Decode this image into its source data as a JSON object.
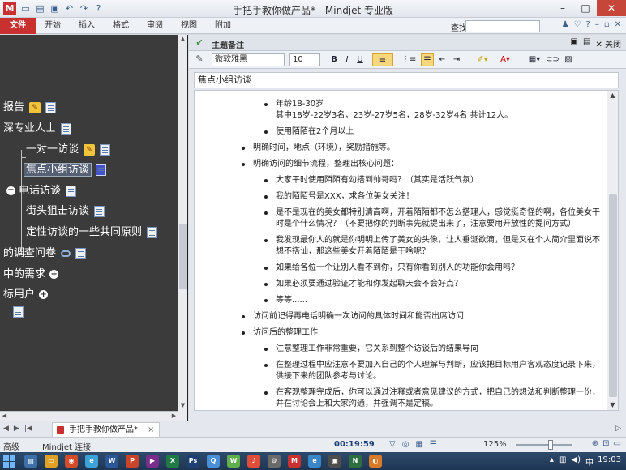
{
  "window": {
    "title": "手把手教你做产品* - Mindjet 专业版"
  },
  "ribbon": {
    "tabs": [
      "文件",
      "开始",
      "插入",
      "格式",
      "审阅",
      "视图",
      "附加"
    ],
    "find_label": "查找"
  },
  "map": {
    "nodes": [
      {
        "label": "报告",
        "badges": [
          "task",
          "note"
        ]
      },
      {
        "label": "深专业人士",
        "badges": [
          "note"
        ]
      },
      {
        "label": "一对一访谈",
        "badges": [
          "task",
          "note"
        ]
      },
      {
        "label": "焦点小组访谈",
        "badges": [
          "note"
        ],
        "selected": true
      },
      {
        "label": "电话访谈",
        "badges": [
          "note"
        ],
        "collapse": true
      },
      {
        "label": "街头狙击访谈",
        "badges": [
          "note"
        ]
      },
      {
        "label": "定性访谈的一些共同原则",
        "badges": [
          "note"
        ]
      },
      {
        "label": "的调查问卷",
        "badges": [
          "link",
          "note"
        ]
      },
      {
        "label": "中的需求",
        "badges": [
          "expand"
        ]
      },
      {
        "label": "标用户",
        "badges": [
          "expand"
        ]
      }
    ]
  },
  "notes": {
    "header_label": "主题备注",
    "close_label": "关闭",
    "font": "微软雅黑",
    "size": "10",
    "topic_title": "焦点小组访谈",
    "items": [
      {
        "level": 2,
        "text": "年龄18-30岁\n其中18岁-22岁3名，23岁-27岁5名，28岁-32岁4名 共计12人。"
      },
      {
        "level": 2,
        "text": "使用陌陌在2个月以上"
      },
      {
        "level": 1,
        "text": "明确时间，地点（环境），奖励措施等。"
      },
      {
        "level": 1,
        "text": "明确访问的细节流程，整理出核心问题："
      },
      {
        "level": 2,
        "text": "大家平时使用陌陌有勾搭到帅哥吗？（其实是活跃气氛）"
      },
      {
        "level": 2,
        "text": "我的陌陌号是XXX，求各位美女关注！"
      },
      {
        "level": 2,
        "text": "是不是现在的美女都特别清高啊，开着陌陌都不怎么搭理人，感觉挺奇怪的啊，各位美女平时是个什么情况？（不要把你的判断事先就提出来了，注意要用开放性的提问方式）"
      },
      {
        "level": 2,
        "text": "我发现最你人的就是你明明上传了美女的头像，让人垂涎欲滴，但是又在个人简介里面说不想不搭讪，那这些美女开着陌陌是干啥呢？"
      },
      {
        "level": 2,
        "text": "如果给各位一个让别人看不到你，只有你看到别人的功能你会用吗？"
      },
      {
        "level": 2,
        "text": "如果必须要通过验证才能和你发起聊天会不会好点？"
      },
      {
        "level": 2,
        "text": "等等......"
      },
      {
        "level": 1,
        "text": "访问前记得再电话明确一次访问的具体时间和能否出席访问"
      },
      {
        "level": 1,
        "text": "访问后的整理工作"
      },
      {
        "level": 2,
        "text": "注意整理工作非常重要，它关系到整个访谈后的结果导向"
      },
      {
        "level": 2,
        "text": "在整理过程中应注意不要加入自己的个人理解与判断，应该把目标用户客观态度记录下来，供接下来的团队参考与讨论。"
      },
      {
        "level": 2,
        "text": "在客观整理完成后，你可以通过注释或者意见建议的方式，把自己的想法和判断整理一份，并在讨论会上和大家沟通，并强调不是定稿。"
      }
    ]
  },
  "doc_tab": {
    "label": "手把手教你做产品*",
    "close": "×"
  },
  "status": {
    "left1": "高级",
    "left2": "Mindjet 连接",
    "timer": "00:19:59",
    "zoom": "125%"
  },
  "taskbar": {
    "clock": "19:03",
    "ime": "中"
  }
}
